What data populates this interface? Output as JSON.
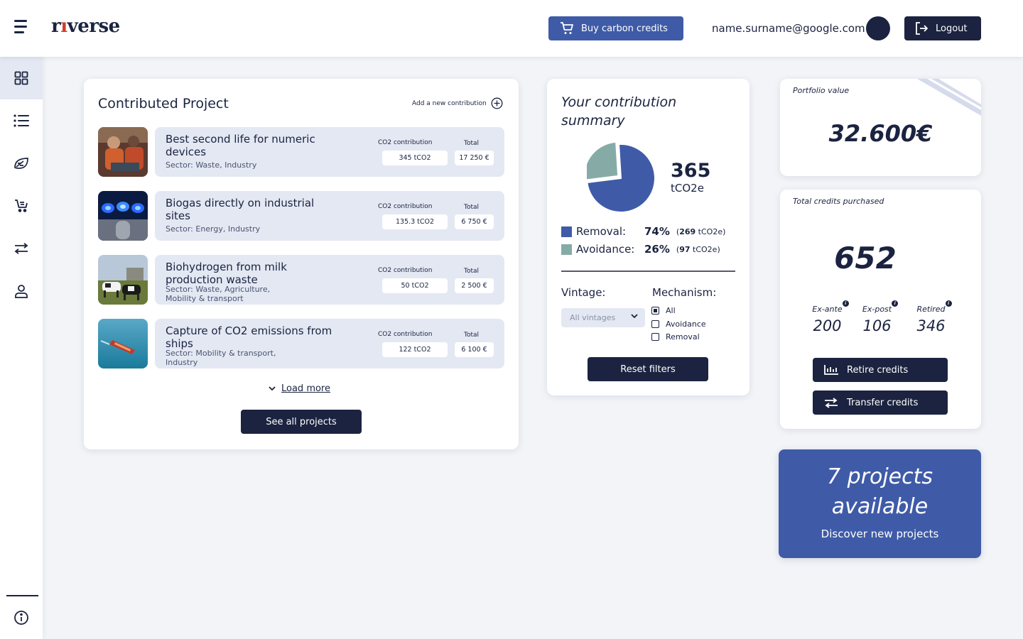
{
  "header": {
    "logo": {
      "pre": "r",
      "dot": "ı",
      "post": "verse"
    },
    "buy_label": "Buy carbon credits",
    "user_email": "name.surname@google.com",
    "logout_label": "Logout"
  },
  "sidebar": {
    "items": [
      "dashboard-icon",
      "list-icon",
      "leaf-icon",
      "cart-icon",
      "transfer-icon",
      "user-icon"
    ],
    "info_icon": "info-icon"
  },
  "projects": {
    "title": "Contributed Project",
    "add_label": "Add a new contribution",
    "co2_header": "CO2 contribution",
    "total_header": "Total",
    "items": [
      {
        "name": "Best second life for numeric devices",
        "sector": "Sector: Waste, Industry",
        "co2": "345 tCO2",
        "total": "17 250 €"
      },
      {
        "name": "Biogas directly on industrial sites",
        "sector": "Sector: Energy, Industry",
        "co2": "135.3 tCO2",
        "total": "6 750 €"
      },
      {
        "name": "Biohydrogen from milk production waste",
        "sector": "Sector: Waste, Agriculture, Mobility & transport",
        "co2": "50 tCO2",
        "total": "2 500 €"
      },
      {
        "name": "Capture of CO2 emissions from ships",
        "sector": "Sector: Mobility & transport, Industry",
        "co2": "122 tCO2",
        "total": "6 100 €"
      }
    ],
    "load_more": "Load more",
    "see_all": "See all projects"
  },
  "summary": {
    "title": "Your contribution summary",
    "total": "365",
    "unit": "tCO2e",
    "removal": {
      "label": "Removal:",
      "pct": "74%",
      "amount": "269",
      "unit": "tCO2e",
      "color": "#3f5ba8"
    },
    "avoidance": {
      "label": "Avoidance:",
      "pct": "26%",
      "amount": "97",
      "unit": "tCO2e",
      "color": "#86aba6"
    },
    "vintage_label": "Vintage:",
    "vintage_value": "All vintages",
    "mechanism_label": "Mechanism:",
    "mechanisms": [
      {
        "label": "All",
        "checked": true
      },
      {
        "label": "Avoidance",
        "checked": false
      },
      {
        "label": "Removal",
        "checked": false
      }
    ],
    "reset_label": "Reset filters"
  },
  "chart_data": {
    "type": "pie",
    "categories": [
      "Removal",
      "Avoidance"
    ],
    "values": [
      74,
      26
    ],
    "title": "",
    "colors": [
      "#3f5ba8",
      "#86aba6"
    ]
  },
  "portfolio": {
    "title": "Portfolio value",
    "value": "32.600€"
  },
  "credits": {
    "title": "Total credits purchased",
    "total": "652",
    "ex_ante_label": "Ex-ante",
    "ex_ante": "200",
    "ex_post_label": "Ex-post",
    "ex_post": "106",
    "retired_label": "Retired",
    "retired": "346",
    "retire_label": "Retire credits",
    "transfer_label": "Transfer credits"
  },
  "discover": {
    "title": "7 projects available",
    "subtitle": "Discover new projects"
  },
  "colors": {
    "navy": "#1b2340",
    "blue": "#3f5ba8",
    "teal": "#86aba6",
    "light": "#e3e8f3"
  }
}
